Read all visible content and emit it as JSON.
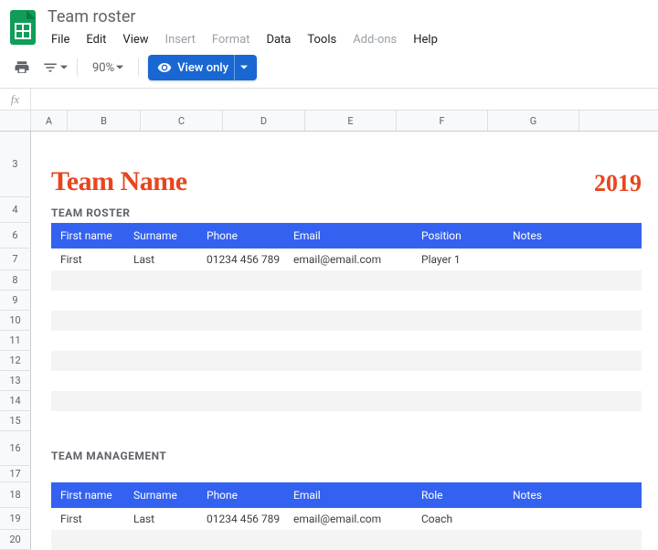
{
  "doc": {
    "title": "Team roster"
  },
  "menus": {
    "file": "File",
    "edit": "Edit",
    "view": "View",
    "insert": "Insert",
    "format": "Format",
    "data": "Data",
    "tools": "Tools",
    "addons": "Add-ons",
    "help": "Help"
  },
  "toolbar": {
    "zoom": "90%",
    "view_only": "View only"
  },
  "fx": {
    "label": "fx"
  },
  "columns": [
    "A",
    "B",
    "C",
    "D",
    "E",
    "F",
    "G"
  ],
  "rows": [
    "3",
    "4",
    "6",
    "7",
    "8",
    "9",
    "10",
    "11",
    "12",
    "13",
    "14",
    "15",
    "16",
    "17",
    "18",
    "19",
    "20"
  ],
  "content": {
    "team_name": "Team Name",
    "year": "2019",
    "roster_title": "TEAM ROSTER",
    "mgmt_title": "TEAM MANAGEMENT",
    "roster_headers": {
      "first": "First name",
      "surname": "Surname",
      "phone": "Phone",
      "email": "Email",
      "position": "Position",
      "notes": "Notes"
    },
    "mgmt_headers": {
      "first": "First name",
      "surname": "Surname",
      "phone": "Phone",
      "email": "Email",
      "role": "Role",
      "notes": "Notes"
    },
    "roster_row": {
      "first": "First",
      "surname": "Last",
      "phone": "01234 456 789",
      "email": "email@email.com",
      "position": "Player 1",
      "notes": ""
    },
    "mgmt_row": {
      "first": "First",
      "surname": "Last",
      "phone": "01234 456 789",
      "email": "email@email.com",
      "role": "Coach",
      "notes": ""
    }
  }
}
